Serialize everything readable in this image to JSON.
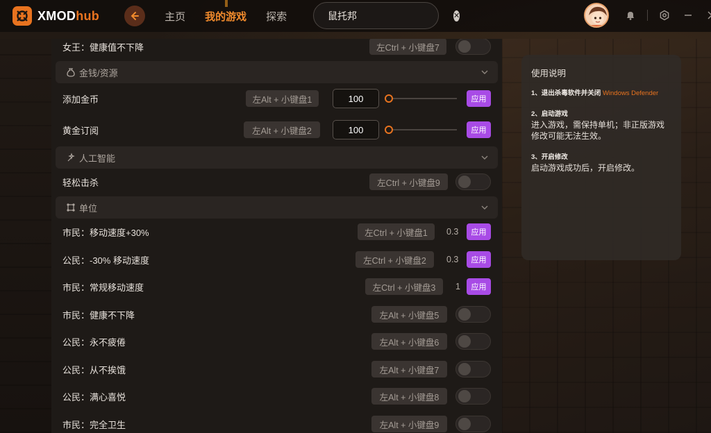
{
  "header": {
    "logo_main": "XMOD",
    "logo_accent": "hub",
    "nav": [
      {
        "label": "主页",
        "active": false
      },
      {
        "label": "我的游戏",
        "active": true
      },
      {
        "label": "探索",
        "active": false
      }
    ],
    "search": {
      "value": "鼠托邦",
      "placeholder": ""
    },
    "icons": [
      "back-arrow-icon",
      "search-icon",
      "clear-icon",
      "notification-bell-icon",
      "settings-icon",
      "minimize-icon",
      "close-icon"
    ]
  },
  "colors": {
    "accent": "#e8731f",
    "apply": "#a84be6",
    "panel": "#1e1a17"
  },
  "rows_top": {
    "queen": {
      "label": "女王：健康值不下降",
      "hotkey": "左Ctrl + 小键盘7"
    }
  },
  "sections": {
    "money": {
      "title": "金钱/资源",
      "icon": "money-bag-icon"
    },
    "ai": {
      "title": "人工智能",
      "icon": "ai-sparkle-icon"
    },
    "unit": {
      "title": "单位",
      "icon": "unit-nodes-icon"
    }
  },
  "money_rows": [
    {
      "label": "添加金币",
      "hotkey": "左Alt + 小键盘1",
      "value": "100",
      "apply": "应用"
    },
    {
      "label": "黄金订阅",
      "hotkey": "左Alt + 小键盘2",
      "value": "100",
      "apply": "应用"
    }
  ],
  "ai_rows": [
    {
      "label": "轻松击杀",
      "hotkey": "左Ctrl + 小键盘9"
    }
  ],
  "unit_rows": [
    {
      "label": "市民：移动速度+30%",
      "hotkey": "左Ctrl + 小键盘1",
      "value": "0.3",
      "apply": "应用"
    },
    {
      "label": "公民：-30% 移动速度",
      "hotkey": "左Ctrl + 小键盘2",
      "value": "0.3",
      "apply": "应用"
    },
    {
      "label": "市民：常规移动速度",
      "hotkey": "左Ctrl + 小键盘3",
      "value": "1",
      "apply": "应用"
    },
    {
      "label": "市民：健康不下降",
      "hotkey": "左Alt + 小键盘5"
    },
    {
      "label": "公民：永不疲倦",
      "hotkey": "左Alt + 小键盘6"
    },
    {
      "label": "公民：从不挨饿",
      "hotkey": "左Alt + 小键盘7"
    },
    {
      "label": "公民：满心喜悦",
      "hotkey": "左Alt + 小键盘8"
    },
    {
      "label": "市民：完全卫生",
      "hotkey": "左Alt + 小键盘9"
    }
  ],
  "info": {
    "title": "使用说明",
    "step1_title": "1、退出杀毒软件并关闭",
    "step1_warn": "Windows Defender",
    "step2_title": "2、启动游戏",
    "step2_desc": "进入游戏，需保持单机；非正版游戏修改可能无法生效。",
    "step3_title": "3、开启修改",
    "step3_desc": "启动游戏成功后，开启修改。"
  }
}
